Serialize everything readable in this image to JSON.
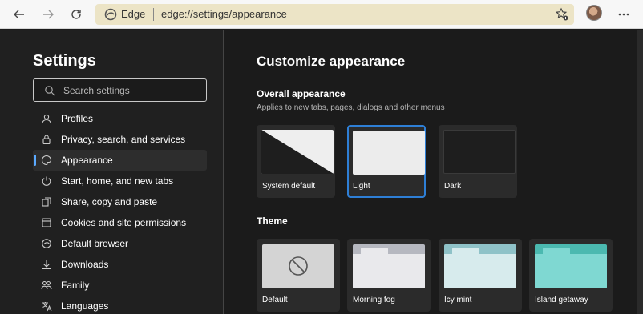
{
  "browser": {
    "app_name": "Edge",
    "url": "edge://settings/appearance",
    "address_bar_color": "#ece4c6"
  },
  "sidebar": {
    "title": "Settings",
    "search_placeholder": "Search settings",
    "items": [
      {
        "label": "Profiles",
        "icon": "profile-icon",
        "active": false
      },
      {
        "label": "Privacy, search, and services",
        "icon": "lock-icon",
        "active": false
      },
      {
        "label": "Appearance",
        "icon": "palette-icon",
        "active": true
      },
      {
        "label": "Start, home, and new tabs",
        "icon": "power-icon",
        "active": false
      },
      {
        "label": "Share, copy and paste",
        "icon": "share-icon",
        "active": false
      },
      {
        "label": "Cookies and site permissions",
        "icon": "cookie-icon",
        "active": false
      },
      {
        "label": "Default browser",
        "icon": "browser-icon",
        "active": false
      },
      {
        "label": "Downloads",
        "icon": "download-icon",
        "active": false
      },
      {
        "label": "Family",
        "icon": "family-icon",
        "active": false
      },
      {
        "label": "Languages",
        "icon": "language-icon",
        "active": false
      }
    ],
    "accent_color": "#5aa9ff"
  },
  "main": {
    "title": "Customize appearance",
    "overall": {
      "title": "Overall appearance",
      "subtitle": "Applies to new tabs, pages, dialogs and other menus",
      "options": [
        {
          "label": "System default",
          "selected": false
        },
        {
          "label": "Light",
          "selected": true
        },
        {
          "label": "Dark",
          "selected": false
        }
      ]
    },
    "theme": {
      "title": "Theme",
      "options": [
        {
          "label": "Default",
          "color": "#cfcfcf"
        },
        {
          "label": "Morning fog",
          "color": "#b6b8c0"
        },
        {
          "label": "Icy mint",
          "color": "#8fc2c8"
        },
        {
          "label": "Island getaway",
          "color": "#4bb9b0"
        }
      ]
    }
  }
}
